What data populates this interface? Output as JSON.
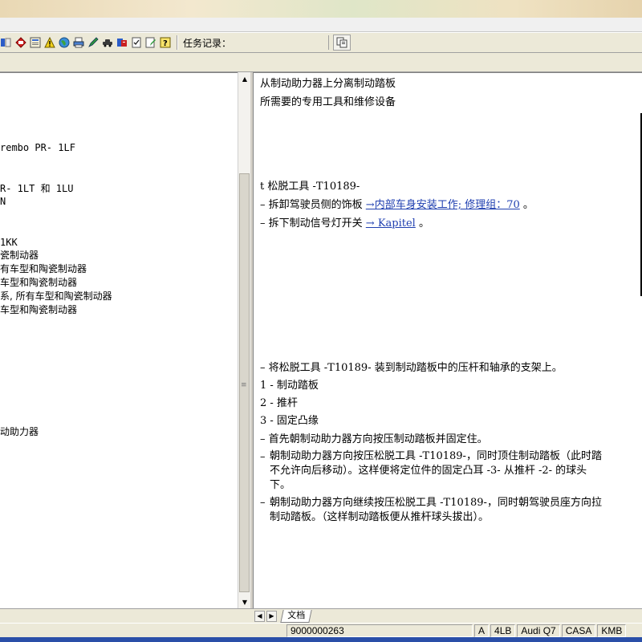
{
  "toolbar": {
    "icons": [
      "blue-mark-icon",
      "red-book-icon",
      "book-icon",
      "warning-icon",
      "globe-icon",
      "printer-icon",
      "green-pen-icon",
      "car-icon",
      "help-book-icon",
      "checklist-icon",
      "edit-icon",
      "question-icon"
    ],
    "task_label": "任务记录：",
    "field_button_icon": "copy-icon"
  },
  "tree": {
    "lines": [
      "rembo PR- 1LF",
      "R- 1LT 和 1LU",
      "N",
      "1KK",
      "瓷制动器",
      "有车型和陶瓷制动器",
      "车型和陶瓷制动器",
      "系, 所有车型和陶瓷制动器",
      "车型和陶瓷制动器",
      "动助力器"
    ]
  },
  "doc": {
    "title": "从制动助力器上分离制动踏板",
    "subtitle": "所需要的专用工具和维修设备",
    "tool_line": "t  松脱工具 -T10189-",
    "step1_text": "拆卸驾驶员侧的饰板",
    "step1_link": "→内部车身安装工作; 修理组：70",
    "step1_end": "。",
    "step2_text": "拆下制动信号灯开关",
    "step2_link": "→ Kapitel",
    "step2_end": "。",
    "step3": "将松脱工具 -T10189- 装到制动踏板中的压杆和轴承的支架上。",
    "legend1": "1 -  制动踏板",
    "legend2": "2 -  推杆",
    "legend3": "3 -  固定凸缘",
    "step4": "首先朝制动助力器方向按压制动踏板并固定住。",
    "step5_l1": "朝制动助力器方向按压松脱工具 -T10189-，同时顶住制动踏板（此时踏",
    "step5_l2": "不允许向后移动）。这样便将定位件的固定凸耳 -3- 从推杆 -2- 的球头",
    "step5_l3": "下。",
    "step6_l1": "朝制动助力器方向继续按压松脱工具 -T10189-，同时朝驾驶员座方向拉",
    "step6_l2": "制动踏板。（这样制动踏板便从推杆球头拔出）。",
    "dash": "–"
  },
  "tabs": {
    "doc_tab": "文档"
  },
  "status": {
    "number": "9000000263",
    "cells": [
      "A",
      "4LB",
      "Audi Q7",
      "CASA",
      "KMB"
    ]
  },
  "colors": {
    "link": "#1f3fb0",
    "chrome": "#ece9d8"
  }
}
